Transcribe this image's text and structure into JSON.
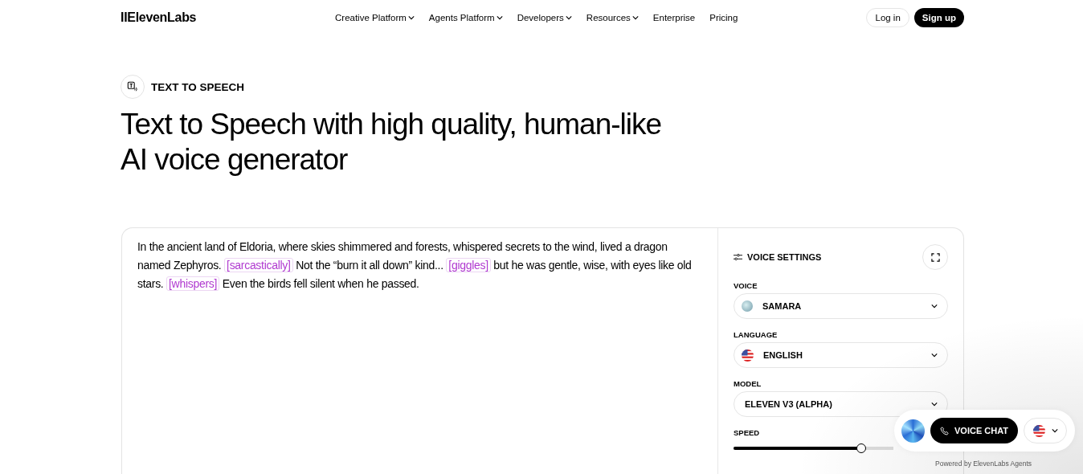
{
  "header": {
    "logo": "IIElevenLabs",
    "nav": [
      {
        "label": "Creative Platform",
        "dropdown": true
      },
      {
        "label": "Agents Platform",
        "dropdown": true
      },
      {
        "label": "Developers",
        "dropdown": true
      },
      {
        "label": "Resources",
        "dropdown": true
      },
      {
        "label": "Enterprise",
        "dropdown": false
      },
      {
        "label": "Pricing",
        "dropdown": false
      }
    ],
    "login": "Log in",
    "signup": "Sign up"
  },
  "hero": {
    "badge": "TEXT TO SPEECH",
    "title": "Text to Speech with high quality, human-like AI voice generator"
  },
  "editor": {
    "segments": [
      {
        "kind": "text",
        "text": "In the ancient land of Eldoria, where skies shimmered and forests, whispered secrets to the wind, lived a dragon named Zephyros. "
      },
      {
        "kind": "tag",
        "text": "[sarcastically]"
      },
      {
        "kind": "text",
        "text": " Not the “burn it all down” kind... "
      },
      {
        "kind": "tag",
        "text": "[giggles]"
      },
      {
        "kind": "text",
        "text": " but he was gentle, wise, with eyes like old stars. "
      },
      {
        "kind": "tag",
        "text": "[whispers]"
      },
      {
        "kind": "text",
        "text": " Even the birds fell silent when he passed."
      }
    ]
  },
  "settings": {
    "title": "VOICE SETTINGS",
    "fields": [
      {
        "label": "VOICE",
        "value": "SAMARA",
        "kind": "avatar"
      },
      {
        "label": "LANGUAGE",
        "value": "ENGLISH",
        "kind": "flag"
      },
      {
        "label": "MODEL",
        "value": "ELEVEN V3 (ALPHA)",
        "kind": "plain"
      }
    ],
    "speed": {
      "label": "SPEED"
    }
  },
  "widget": {
    "button": "VOICE CHAT",
    "footer": "Powered by ElevenLabs Agents"
  }
}
